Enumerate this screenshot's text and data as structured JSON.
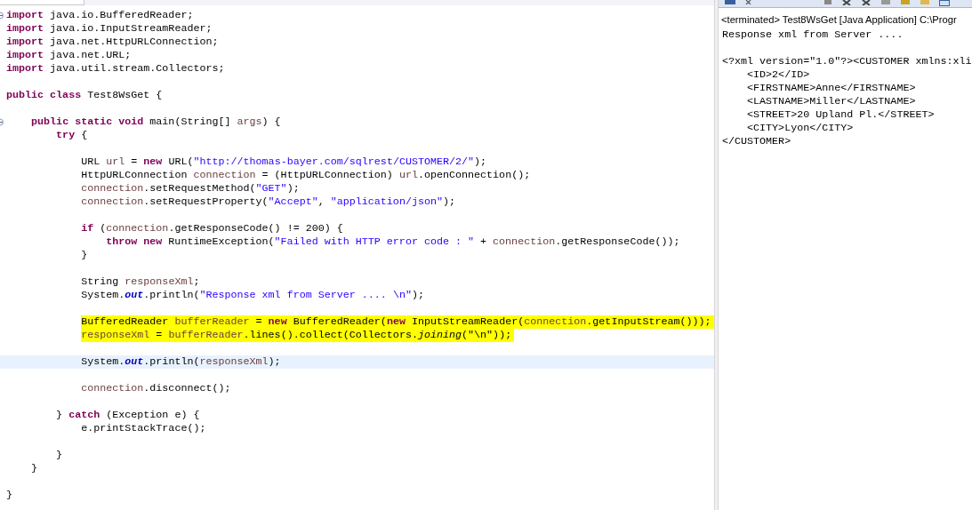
{
  "editor": {
    "lines": [
      {
        "kind": "code",
        "fold": true,
        "marked": false,
        "current": false,
        "tokens": [
          {
            "kind": "kw",
            "text": "import"
          },
          " java.io.BufferedReader;"
        ]
      },
      {
        "kind": "code",
        "fold": false,
        "marked": false,
        "current": false,
        "tokens": [
          {
            "kind": "kw",
            "text": "import"
          },
          " java.io.InputStreamReader;"
        ]
      },
      {
        "kind": "code",
        "fold": false,
        "marked": false,
        "current": false,
        "tokens": [
          {
            "kind": "kw",
            "text": "import"
          },
          " java.net.HttpURLConnection;"
        ]
      },
      {
        "kind": "code",
        "fold": false,
        "marked": false,
        "current": false,
        "tokens": [
          {
            "kind": "kw",
            "text": "import"
          },
          " java.net.URL;"
        ]
      },
      {
        "kind": "code",
        "fold": false,
        "marked": false,
        "current": false,
        "tokens": [
          {
            "kind": "kw",
            "text": "import"
          },
          " java.util.stream.Collectors;"
        ]
      },
      {
        "kind": "blank",
        "fold": false,
        "marked": false,
        "current": false
      },
      {
        "kind": "code",
        "fold": false,
        "marked": false,
        "current": false,
        "tokens": [
          {
            "kind": "kw",
            "text": "public class"
          },
          " Test8WsGet {"
        ]
      },
      {
        "kind": "blank",
        "fold": false,
        "marked": false,
        "current": false
      },
      {
        "kind": "code",
        "fold": true,
        "marked": false,
        "current": false,
        "tokens": [
          {
            "kind": "kw",
            "text": "    public static void"
          },
          " main(String[] ",
          {
            "kind": "var",
            "text": "args"
          },
          ") {"
        ]
      },
      {
        "kind": "code",
        "fold": false,
        "marked": false,
        "current": false,
        "tokens": [
          {
            "kind": "kw",
            "text": "        try"
          },
          " {"
        ]
      },
      {
        "kind": "blank",
        "fold": false,
        "marked": false,
        "current": false
      },
      {
        "kind": "code",
        "fold": false,
        "marked": false,
        "current": false,
        "tokens": [
          "            URL ",
          {
            "kind": "var",
            "text": "url"
          },
          " = ",
          {
            "kind": "kw",
            "text": "new"
          },
          " URL(",
          {
            "kind": "str",
            "text": "\"http://thomas-bayer.com/sqlrest/CUSTOMER/2/\""
          },
          ");"
        ]
      },
      {
        "kind": "code",
        "fold": false,
        "marked": false,
        "current": false,
        "tokens": [
          "            HttpURLConnection ",
          {
            "kind": "var",
            "text": "connection"
          },
          " = (HttpURLConnection) ",
          {
            "kind": "var",
            "text": "url"
          },
          ".openConnection();"
        ]
      },
      {
        "kind": "code",
        "fold": false,
        "marked": false,
        "current": false,
        "tokens": [
          {
            "kind": "var",
            "text": "            connection"
          },
          ".setRequestMethod(",
          {
            "kind": "str",
            "text": "\"GET\""
          },
          ");"
        ]
      },
      {
        "kind": "code",
        "fold": false,
        "marked": false,
        "current": false,
        "tokens": [
          {
            "kind": "var",
            "text": "            connection"
          },
          ".setRequestProperty(",
          {
            "kind": "str",
            "text": "\"Accept\""
          },
          ", ",
          {
            "kind": "str",
            "text": "\"application/json\""
          },
          ");"
        ]
      },
      {
        "kind": "blank",
        "fold": false,
        "marked": false,
        "current": false
      },
      {
        "kind": "code",
        "fold": false,
        "marked": false,
        "current": false,
        "tokens": [
          {
            "kind": "kw",
            "text": "            if"
          },
          " (",
          {
            "kind": "var",
            "text": "connection"
          },
          ".getResponseCode() != 200) {"
        ]
      },
      {
        "kind": "code",
        "fold": false,
        "marked": false,
        "current": false,
        "tokens": [
          {
            "kind": "kw",
            "text": "                throw new"
          },
          " RuntimeException(",
          {
            "kind": "str",
            "text": "\"Failed with HTTP error code : \""
          },
          " + ",
          {
            "kind": "var",
            "text": "connection"
          },
          ".getResponseCode());"
        ]
      },
      {
        "kind": "code",
        "fold": false,
        "marked": false,
        "current": false,
        "tokens": [
          "            }"
        ]
      },
      {
        "kind": "blank",
        "fold": false,
        "marked": false,
        "current": false
      },
      {
        "kind": "code",
        "fold": false,
        "marked": false,
        "current": false,
        "tokens": [
          "            String ",
          {
            "kind": "var",
            "text": "responseXml"
          },
          ";"
        ]
      },
      {
        "kind": "code",
        "fold": false,
        "marked": false,
        "current": false,
        "tokens": [
          "            System.",
          {
            "kind": "field",
            "text": "out"
          },
          ".println(",
          {
            "kind": "str",
            "text": "\"Response xml from Server .... \\n\""
          },
          ");"
        ]
      },
      {
        "kind": "blank",
        "fold": false,
        "marked": false,
        "current": false
      },
      {
        "kind": "code",
        "fold": false,
        "marked": true,
        "current": false,
        "tokens": [
          "            BufferedReader ",
          {
            "kind": "var",
            "text": "bufferReader"
          },
          " = ",
          {
            "kind": "kw",
            "text": "new"
          },
          " BufferedReader(",
          {
            "kind": "kw",
            "text": "new"
          },
          " InputStreamReader(",
          {
            "kind": "var",
            "text": "connection"
          },
          ".getInputStream()));"
        ]
      },
      {
        "kind": "code",
        "fold": false,
        "marked": true,
        "current": false,
        "tokens": [
          {
            "kind": "var",
            "text": "            responseXml"
          },
          " = ",
          {
            "kind": "var",
            "text": "bufferReader"
          },
          ".lines().collect(Collectors.",
          {
            "kind": "static",
            "text": "joining"
          },
          "(\"\\n\"));"
        ]
      },
      {
        "kind": "blank",
        "fold": false,
        "marked": false,
        "current": false
      },
      {
        "kind": "code",
        "fold": false,
        "marked": false,
        "current": true,
        "tokens": [
          "            System.",
          {
            "kind": "field",
            "text": "out"
          },
          ".println(",
          {
            "kind": "var",
            "text": "responseXml"
          },
          ");"
        ]
      },
      {
        "kind": "blank",
        "fold": false,
        "marked": false,
        "current": false
      },
      {
        "kind": "code",
        "fold": false,
        "marked": false,
        "current": false,
        "tokens": [
          {
            "kind": "var",
            "text": "            connection"
          },
          ".disconnect();"
        ]
      },
      {
        "kind": "blank",
        "fold": false,
        "marked": false,
        "current": false
      },
      {
        "kind": "code",
        "fold": false,
        "marked": false,
        "current": false,
        "tokens": [
          "        } ",
          {
            "kind": "kw",
            "text": "catch"
          },
          " (Exception e) {"
        ]
      },
      {
        "kind": "code",
        "fold": false,
        "marked": false,
        "current": false,
        "tokens": [
          "            e.printStackTrace();"
        ]
      },
      {
        "kind": "blank",
        "fold": false,
        "marked": false,
        "current": false
      },
      {
        "kind": "code",
        "fold": false,
        "marked": false,
        "current": false,
        "tokens": [
          "        }"
        ]
      },
      {
        "kind": "code",
        "fold": false,
        "marked": false,
        "current": false,
        "tokens": [
          "    }"
        ]
      },
      {
        "kind": "blank",
        "fold": false,
        "marked": false,
        "current": false
      },
      {
        "kind": "code",
        "fold": false,
        "marked": false,
        "current": false,
        "tokens": [
          "}"
        ]
      }
    ]
  },
  "console": {
    "status": "<terminated> Test8WsGet [Java Application] C:\\Progr",
    "output": [
      {
        "kind": "text",
        "text": "Response xml from Server ...."
      },
      {
        "kind": "blank"
      },
      {
        "kind": "text",
        "text": "<?xml version=\"1.0\"?><CUSTOMER xmlns:xli"
      },
      {
        "kind": "text",
        "text": "    <ID>2</ID>"
      },
      {
        "kind": "text",
        "text": "    <FIRSTNAME>Anne</FIRSTNAME>"
      },
      {
        "kind": "text",
        "text": "    <LASTNAME>Miller</LASTNAME>"
      },
      {
        "kind": "text",
        "text": "    <STREET>20 Upland Pl.</STREET>"
      },
      {
        "kind": "text",
        "text": "    <CITY>Lyon</CITY>"
      },
      {
        "kind": "text",
        "text": "</CUSTOMER>"
      }
    ]
  }
}
